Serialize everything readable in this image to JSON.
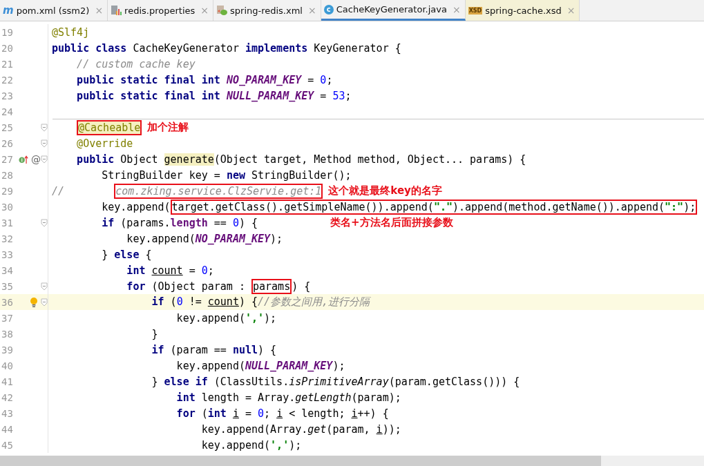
{
  "tabs": [
    {
      "label": "pom.xml (ssm2)",
      "kind": "maven",
      "icon_text": "m",
      "close": "×",
      "selected": false,
      "color": "#f2f2f2"
    },
    {
      "label": "redis.properties",
      "kind": "properties",
      "close": "×",
      "selected": false,
      "color": "#f2f2f2"
    },
    {
      "label": "spring-redis.xml",
      "kind": "spring",
      "close": "×",
      "selected": false,
      "color": "#f2f2f2"
    },
    {
      "label": "CacheKeyGenerator.java",
      "kind": "class",
      "icon_text": "c",
      "close": "×",
      "selected": true,
      "color": "#f2f2f2"
    },
    {
      "label": "spring-cache.xsd",
      "kind": "xsd",
      "icon_text": "XSD",
      "close": "×",
      "selected": false,
      "color": "#f4f1d6"
    }
  ],
  "lines": [
    {
      "number": "19",
      "tokens": [
        {
          "text": "@Slf4j",
          "kind": "annotation"
        }
      ]
    },
    {
      "number": "20",
      "tokens": [
        {
          "text": "public class",
          "kind": "keyword"
        },
        {
          "text": " CacheKeyGenerator ",
          "kind": "plain"
        },
        {
          "text": "implements",
          "kind": "keyword"
        },
        {
          "text": " KeyGenerator {",
          "kind": "plain"
        }
      ]
    },
    {
      "number": "21",
      "tokens": [
        {
          "text": "    // custom cache key",
          "kind": "comment"
        }
      ]
    },
    {
      "number": "22",
      "tokens": [
        {
          "text": "    public static final int ",
          "kind": "keyword"
        },
        {
          "text": "NO_PARAM_KEY",
          "kind": "constant"
        },
        {
          "text": " = ",
          "kind": "plain"
        },
        {
          "text": "0",
          "kind": "number"
        },
        {
          "text": ";",
          "kind": "plain"
        }
      ]
    },
    {
      "number": "23",
      "tokens": [
        {
          "text": "    public static final int ",
          "kind": "keyword"
        },
        {
          "text": "NULL_PARAM_KEY",
          "kind": "constant"
        },
        {
          "text": " = ",
          "kind": "plain"
        },
        {
          "text": "53",
          "kind": "number"
        },
        {
          "text": ";",
          "kind": "plain"
        }
      ]
    },
    {
      "number": "24",
      "separator": true
    },
    {
      "number": "25",
      "fold": true,
      "tokens": [
        {
          "kind": "box",
          "children": [
            {
              "text": "@Cacheable",
              "kind": "highlighted-annotation"
            }
          ]
        }
      ],
      "note": "加个注解"
    },
    {
      "number": "26",
      "fold": true,
      "tokens": [
        {
          "text": "    @Override",
          "kind": "annotation"
        }
      ]
    },
    {
      "number": "27",
      "fold": true,
      "gutter_icons": [
        {
          "kind": "implements"
        },
        {
          "kind": "override",
          "text": "@"
        }
      ],
      "tokens": [
        {
          "text": "    public",
          "kind": "keyword"
        },
        {
          "text": " Object ",
          "kind": "plain"
        },
        {
          "text": "generate",
          "kind": "highlighted"
        },
        {
          "text": "(Object target, Method method, Object... params) {",
          "kind": "plain"
        }
      ]
    },
    {
      "number": "28",
      "tokens": [
        {
          "text": "        StringBuilder key = ",
          "kind": "plain"
        },
        {
          "text": "new",
          "kind": "keyword"
        },
        {
          "text": " StringBuilder();",
          "kind": "plain"
        }
      ]
    },
    {
      "number": "29",
      "tokens": [
        {
          "text": "//        ",
          "kind": "comment"
        },
        {
          "kind": "box",
          "children": [
            {
              "text": "com.zking.service.ClzServie.get:1",
              "kind": "comment"
            }
          ]
        }
      ],
      "note": "这个就是最终key的名字"
    },
    {
      "number": "30",
      "tokens": [
        {
          "text": "        key.append(",
          "kind": "plain"
        },
        {
          "kind": "box",
          "children": [
            {
              "text": "target.getClass().getSimpleName()).append(",
              "kind": "plain"
            },
            {
              "text": "\".\"",
              "kind": "string"
            },
            {
              "text": ").append(method.getName()).append(",
              "kind": "plain"
            },
            {
              "text": "\":\"",
              "kind": "string"
            },
            {
              "text": ");",
              "kind": "plain"
            }
          ]
        }
      ]
    },
    {
      "number": "31",
      "fold": true,
      "tokens": [
        {
          "text": "        if",
          "kind": "keyword"
        },
        {
          "text": " (params.",
          "kind": "plain"
        },
        {
          "text": "length",
          "kind": "field"
        },
        {
          "text": " == ",
          "kind": "plain"
        },
        {
          "text": "0",
          "kind": "number"
        },
        {
          "text": ") {",
          "kind": "plain"
        }
      ],
      "note": "类名+方法名后面拼接参数"
    },
    {
      "number": "32",
      "tokens": [
        {
          "text": "            key.append(",
          "kind": "plain"
        },
        {
          "text": "NO_PARAM_KEY",
          "kind": "constant"
        },
        {
          "text": ");",
          "kind": "plain"
        }
      ]
    },
    {
      "number": "33",
      "tokens": [
        {
          "text": "        } ",
          "kind": "plain"
        },
        {
          "text": "else",
          "kind": "keyword"
        },
        {
          "text": " {",
          "kind": "plain"
        }
      ]
    },
    {
      "number": "34",
      "tokens": [
        {
          "text": "            int ",
          "kind": "keyword"
        },
        {
          "text": "count",
          "kind": "reassigned"
        },
        {
          "text": " = ",
          "kind": "plain"
        },
        {
          "text": "0",
          "kind": "number"
        },
        {
          "text": ";",
          "kind": "plain"
        }
      ]
    },
    {
      "number": "35",
      "fold": true,
      "tokens": [
        {
          "text": "            for",
          "kind": "keyword"
        },
        {
          "text": " (Object param : ",
          "kind": "plain"
        },
        {
          "kind": "box",
          "children": [
            {
              "text": "params",
              "kind": "plain"
            }
          ]
        },
        {
          "text": ") {",
          "kind": "plain"
        }
      ]
    },
    {
      "number": "36",
      "fold": true,
      "current": true,
      "gutter_icons": [
        {
          "kind": "bulb"
        }
      ],
      "tokens": [
        {
          "text": "                if",
          "kind": "keyword"
        },
        {
          "text": " (",
          "kind": "plain"
        },
        {
          "text": "0",
          "kind": "number"
        },
        {
          "text": " != ",
          "kind": "plain"
        },
        {
          "text": "count",
          "kind": "reassigned"
        },
        {
          "text": ") {",
          "kind": "plain"
        },
        {
          "text": "//参数之间用,进行分隔",
          "kind": "comment"
        }
      ]
    },
    {
      "number": "37",
      "tokens": [
        {
          "text": "                    key.append(",
          "kind": "plain"
        },
        {
          "text": "','",
          "kind": "string"
        },
        {
          "text": ");",
          "kind": "plain"
        }
      ]
    },
    {
      "number": "38",
      "tokens": [
        {
          "text": "                }",
          "kind": "plain"
        }
      ]
    },
    {
      "number": "39",
      "tokens": [
        {
          "text": "                if",
          "kind": "keyword"
        },
        {
          "text": " (param == ",
          "kind": "plain"
        },
        {
          "text": "null",
          "kind": "keyword"
        },
        {
          "text": ") {",
          "kind": "plain"
        }
      ]
    },
    {
      "number": "40",
      "tokens": [
        {
          "text": "                    key.append(",
          "kind": "plain"
        },
        {
          "text": "NULL_PARAM_KEY",
          "kind": "constant"
        },
        {
          "text": ");",
          "kind": "plain"
        }
      ]
    },
    {
      "number": "41",
      "tokens": [
        {
          "text": "                } ",
          "kind": "plain"
        },
        {
          "text": "else if",
          "kind": "keyword"
        },
        {
          "text": " (ClassUtils.",
          "kind": "plain"
        },
        {
          "text": "isPrimitiveArray",
          "kind": "static"
        },
        {
          "text": "(param.getClass())) {",
          "kind": "plain"
        }
      ]
    },
    {
      "number": "42",
      "tokens": [
        {
          "text": "                    int",
          "kind": "keyword"
        },
        {
          "text": " length = Array.",
          "kind": "plain"
        },
        {
          "text": "getLength",
          "kind": "static"
        },
        {
          "text": "(param);",
          "kind": "plain"
        }
      ]
    },
    {
      "number": "43",
      "tokens": [
        {
          "text": "                    for",
          "kind": "keyword"
        },
        {
          "text": " (",
          "kind": "plain"
        },
        {
          "text": "int ",
          "kind": "keyword"
        },
        {
          "text": "i",
          "kind": "reassigned"
        },
        {
          "text": " = ",
          "kind": "plain"
        },
        {
          "text": "0",
          "kind": "number"
        },
        {
          "text": "; ",
          "kind": "plain"
        },
        {
          "text": "i",
          "kind": "reassigned"
        },
        {
          "text": " < length; ",
          "kind": "plain"
        },
        {
          "text": "i",
          "kind": "reassigned"
        },
        {
          "text": "++) {",
          "kind": "plain"
        }
      ]
    },
    {
      "number": "44",
      "tokens": [
        {
          "text": "                        key.append(Array.",
          "kind": "plain"
        },
        {
          "text": "get",
          "kind": "static"
        },
        {
          "text": "(param, ",
          "kind": "plain"
        },
        {
          "text": "i",
          "kind": "reassigned"
        },
        {
          "text": "));",
          "kind": "plain"
        }
      ]
    },
    {
      "number": "45",
      "tokens": [
        {
          "text": "                        key.append(",
          "kind": "plain"
        },
        {
          "text": "','",
          "kind": "string"
        },
        {
          "text": ");",
          "kind": "plain"
        }
      ]
    }
  ]
}
